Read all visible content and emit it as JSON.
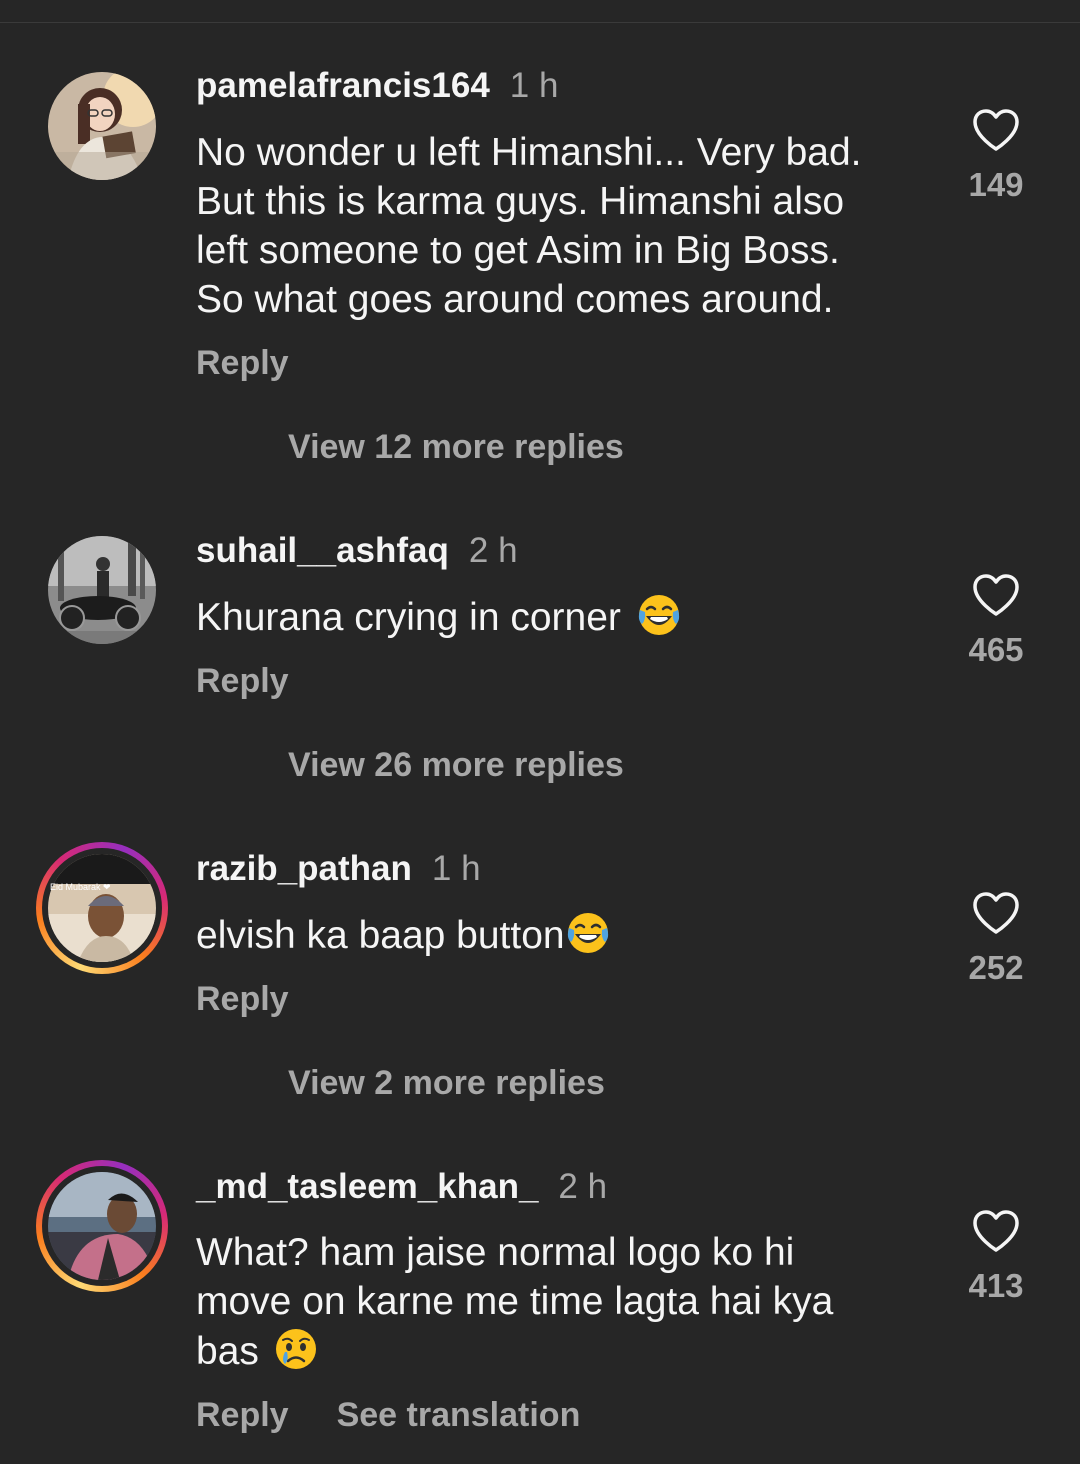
{
  "comments": [
    {
      "username": "pamelafrancis164",
      "time": "1 h",
      "text_lines": [
        "No wonder u left Himanshi... Very bad.",
        "But this is karma guys. Himanshi also",
        "left someone to get Asim in Big Boss.",
        "So what goes around comes around."
      ],
      "reply_label": "Reply",
      "likes": "149",
      "view_replies": "View 12 more replies",
      "has_story_ring": false
    },
    {
      "username": "suhail__ashfaq",
      "time": "2 h",
      "text": "Khurana crying in corner",
      "emoji": "tears-of-joy",
      "reply_label": "Reply",
      "likes": "465",
      "view_replies": "View 26 more replies",
      "has_story_ring": false
    },
    {
      "username": "razib_pathan",
      "time": "1 h",
      "text": "elvish ka baap button",
      "emoji": "tears-of-joy",
      "reply_label": "Reply",
      "likes": "252",
      "view_replies": "View 2 more replies",
      "has_story_ring": true,
      "avatar_caption": "Eid Mubarak ❤"
    },
    {
      "username": "_md_tasleem_khan_",
      "time": "2 h",
      "text_lines": [
        "What? ham jaise normal logo ko hi",
        "move on karne me time lagta hai kya",
        "bas"
      ],
      "emoji": "crying-face",
      "reply_label": "Reply",
      "see_translation": "See translation",
      "likes": "413",
      "has_story_ring": true
    }
  ],
  "colors": {
    "background": "#262626",
    "primary_text": "#f5f5f5",
    "secondary_text": "#a8a8a8"
  }
}
